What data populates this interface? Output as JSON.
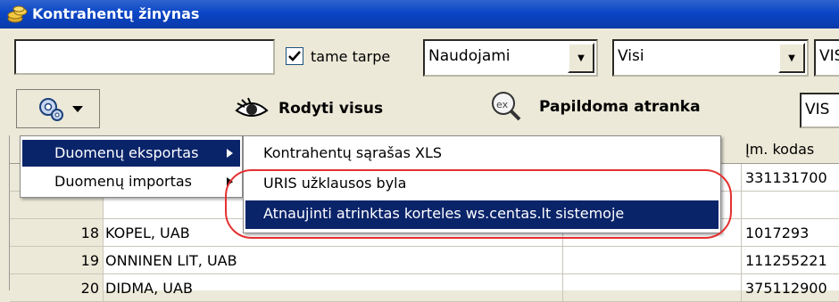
{
  "window": {
    "title": "Kontrahentų žinynas"
  },
  "filters": {
    "search_value": "",
    "checkbox_label": "tame tarpe",
    "checkbox_checked": true,
    "select1": "Naudojami",
    "select2": "Visi",
    "select3": "VIS",
    "select4": "VIS"
  },
  "toolbar": {
    "show_all_label": "Rodyti visus",
    "extra_filter_label": "Papildoma atranka"
  },
  "grid": {
    "col_code_header": "Įm. kodas",
    "rows": [
      {
        "num": "",
        "name": "",
        "code": "331131700"
      },
      {
        "num": "",
        "name": "",
        "code": ""
      },
      {
        "num": "18",
        "name": "KOPEL, UAB",
        "code": "1017293"
      },
      {
        "num": "19",
        "name": "ONNINEN LIT, UAB",
        "code": "111255221"
      },
      {
        "num": "20",
        "name": "DIDMA, UAB",
        "code": "375112900"
      }
    ]
  },
  "menu": {
    "items": [
      "Duomenų eksportas",
      "Duomenų importas"
    ],
    "submenu": [
      "Kontrahentų sąrašas XLS",
      "URIS užklausos byla",
      "Atnaujinti atrinktas korteles ws.centas.lt sistemoje"
    ]
  },
  "colors": {
    "title_bar": "#0a46c7",
    "selection": "#0a246a",
    "highlight_ring": "#e53030"
  }
}
